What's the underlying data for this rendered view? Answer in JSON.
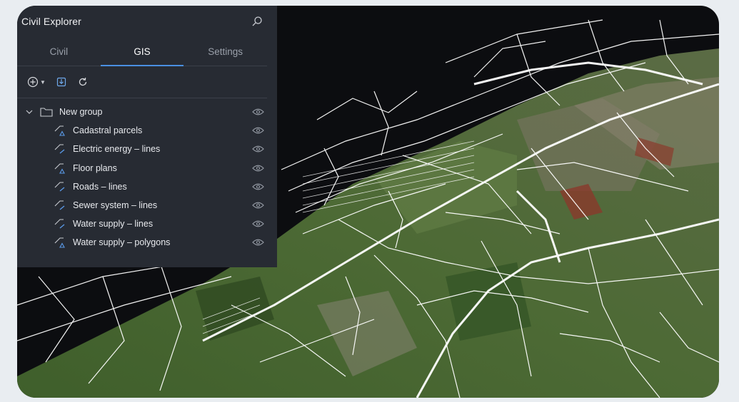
{
  "panel": {
    "title": "Civil Explorer"
  },
  "tabs": [
    {
      "label": "Civil",
      "active": false
    },
    {
      "label": "GIS",
      "active": true
    },
    {
      "label": "Settings",
      "active": false
    }
  ],
  "toolbar": {
    "icons": [
      "add-icon",
      "dropdown-caret-icon",
      "import-icon",
      "refresh-icon"
    ]
  },
  "tree": {
    "group": {
      "label": "New group",
      "expanded": true
    },
    "layers": [
      {
        "label": "Cadastral parcels",
        "icon": "polygon-layer-icon"
      },
      {
        "label": "Electric energy – lines",
        "icon": "line-layer-icon"
      },
      {
        "label": "Floor plans",
        "icon": "polygon-layer-icon"
      },
      {
        "label": "Roads – lines",
        "icon": "line-layer-icon"
      },
      {
        "label": "Sewer system – lines",
        "icon": "line-layer-icon"
      },
      {
        "label": "Water supply – lines",
        "icon": "line-layer-icon"
      },
      {
        "label": "Water supply – polygons",
        "icon": "polygon-layer-icon"
      }
    ]
  },
  "colors": {
    "panel_bg": "#272b33",
    "accent": "#4a90e2",
    "map_background": "#0c0d10",
    "terrain": "#3d5a2c",
    "road_lines": "#ffffff"
  }
}
